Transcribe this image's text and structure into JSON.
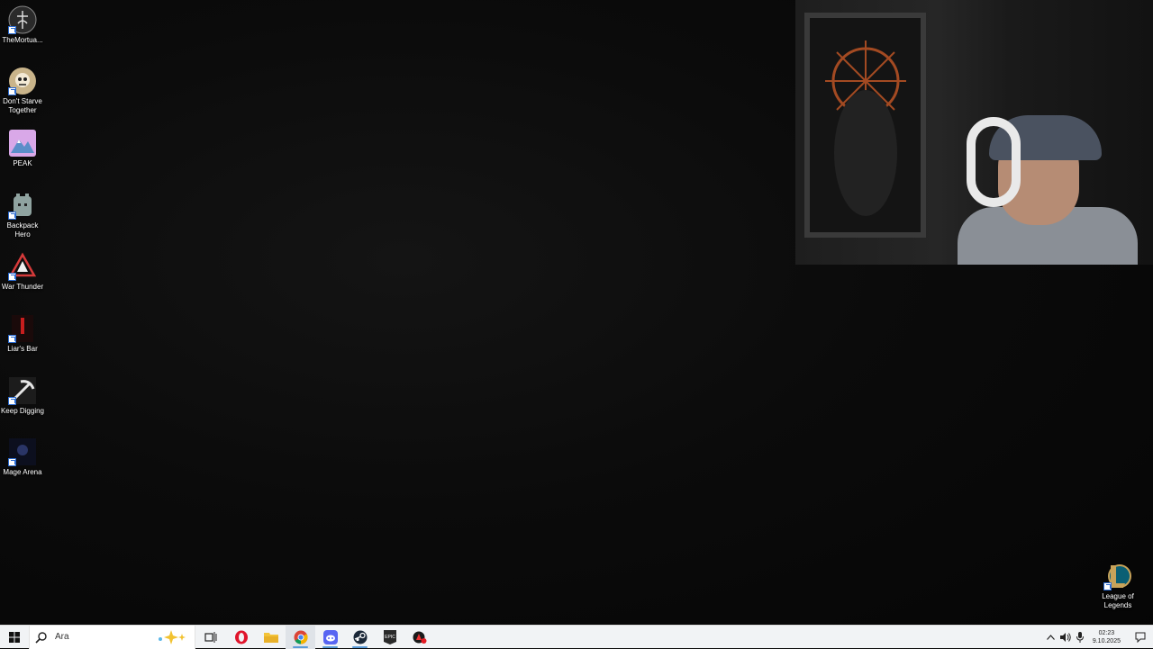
{
  "desktop": {
    "icons": [
      {
        "label": "TheMortua...",
        "icon": "mortuary-icon"
      },
      {
        "label": "Don't Starve\nTogether",
        "icon": "dont-starve-icon"
      },
      {
        "label": "PEAK",
        "icon": "peak-icon"
      },
      {
        "label": "Backpack\nHero",
        "icon": "backpack-hero-icon"
      },
      {
        "label": "War Thunder",
        "icon": "war-thunder-icon"
      },
      {
        "label": "Liar's Bar",
        "icon": "liars-bar-icon"
      },
      {
        "label": "Keep Digging",
        "icon": "keep-digging-icon"
      },
      {
        "label": "Mage Arena",
        "icon": "mage-arena-icon"
      }
    ],
    "corner_icon": {
      "label": "League of\nLegends",
      "icon": "league-of-legends-icon"
    }
  },
  "taskbar": {
    "search_label": "Ara",
    "apps": [
      {
        "name": "task-view",
        "icon": "task-view-icon",
        "running": false
      },
      {
        "name": "opera",
        "icon": "opera-icon",
        "running": false
      },
      {
        "name": "file-explorer",
        "icon": "folder-icon",
        "running": false
      },
      {
        "name": "chrome",
        "icon": "chrome-icon",
        "running": true
      },
      {
        "name": "discord",
        "icon": "discord-icon",
        "running": true
      },
      {
        "name": "steam",
        "icon": "steam-icon",
        "running": true
      },
      {
        "name": "epic-games",
        "icon": "epic-games-icon",
        "running": false
      },
      {
        "name": "riot-client",
        "icon": "riot-icon",
        "running": false
      }
    ],
    "clock": {
      "time": "02:23",
      "date": "9.10.2025"
    }
  },
  "colors": {
    "taskbar_bg": "#f1f3f5",
    "desktop_bg": "#0b0b0b",
    "accent_running": "#5a9bd8"
  }
}
